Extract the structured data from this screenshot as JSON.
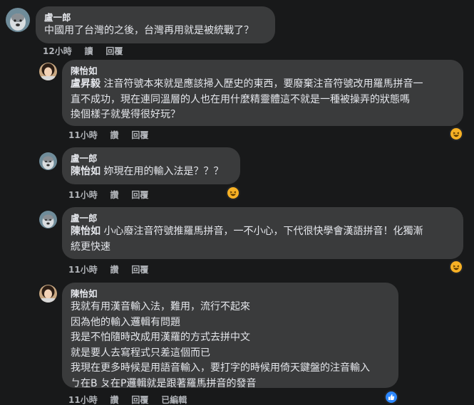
{
  "comments": [
    {
      "author": "盧一郎",
      "body_lines": [
        "中國用了台灣的之後，台灣再用就是被統戰了？"
      ],
      "time": "12小時",
      "reply": "讀",
      "respond": "回覆"
    },
    {
      "author": "陳怡如",
      "tag": "盧昇毅",
      "body_lines": [
        "注音符號本來就是應該掃入歷史的東西，要廢棄注音符號改用羅馬拼音一",
        "直不成功，現在連同溫層的人也在用什麼精靈體這不就是一種被操弄的狀態嗎",
        "換個樣子就覺得很好玩？"
      ],
      "time": "11小時",
      "reply": "讚",
      "respond": "回覆",
      "reaction_icon": "haha-reaction-icon"
    },
    {
      "author": "盧一郎",
      "tag": "陳怡如",
      "body_lines": [
        "妳現在用的輸入法是？？？"
      ],
      "time": "11小時",
      "reply": "讚",
      "respond": "回覆",
      "reaction_icon": "haha-reaction-icon"
    },
    {
      "author": "盧一郎",
      "tag": "陳怡如",
      "body_lines": [
        "小心廢注音符號推羅馬拼音，一不小心，下代很快學會漢語拼音！化獨漸",
        "統更快速"
      ],
      "time": "11小時",
      "reply": "讚",
      "respond": "回覆",
      "reaction_icon": "haha-reaction-icon"
    },
    {
      "author": "陳怡如",
      "body_lines": [
        "我就有用漢音輸入法，難用，流行不起來",
        "因為他的輸入邏輯有問題",
        "我是不怕隨時改成用漢羅的方式去拼中文",
        "就是要人去寫程式只差這個而已",
        "我現在更多時候是用語音輸入，要打字的時候用倚天鍵盤的注音輸入",
        "ㄅ在B ㄆ在P邏輯就是跟著羅馬拼音的發音"
      ],
      "time": "11小時",
      "reply": "讚",
      "respond": "回覆",
      "edited": "已編輯",
      "reaction_icon": "like-reaction-icon"
    }
  ],
  "colors": {
    "background": "#18191a",
    "bubble": "#3a3b3c",
    "text": "#e4e6eb",
    "secondary": "#b0b3b8",
    "like_blue": "#2d88ff",
    "haha_yellow": "#f7b125"
  }
}
